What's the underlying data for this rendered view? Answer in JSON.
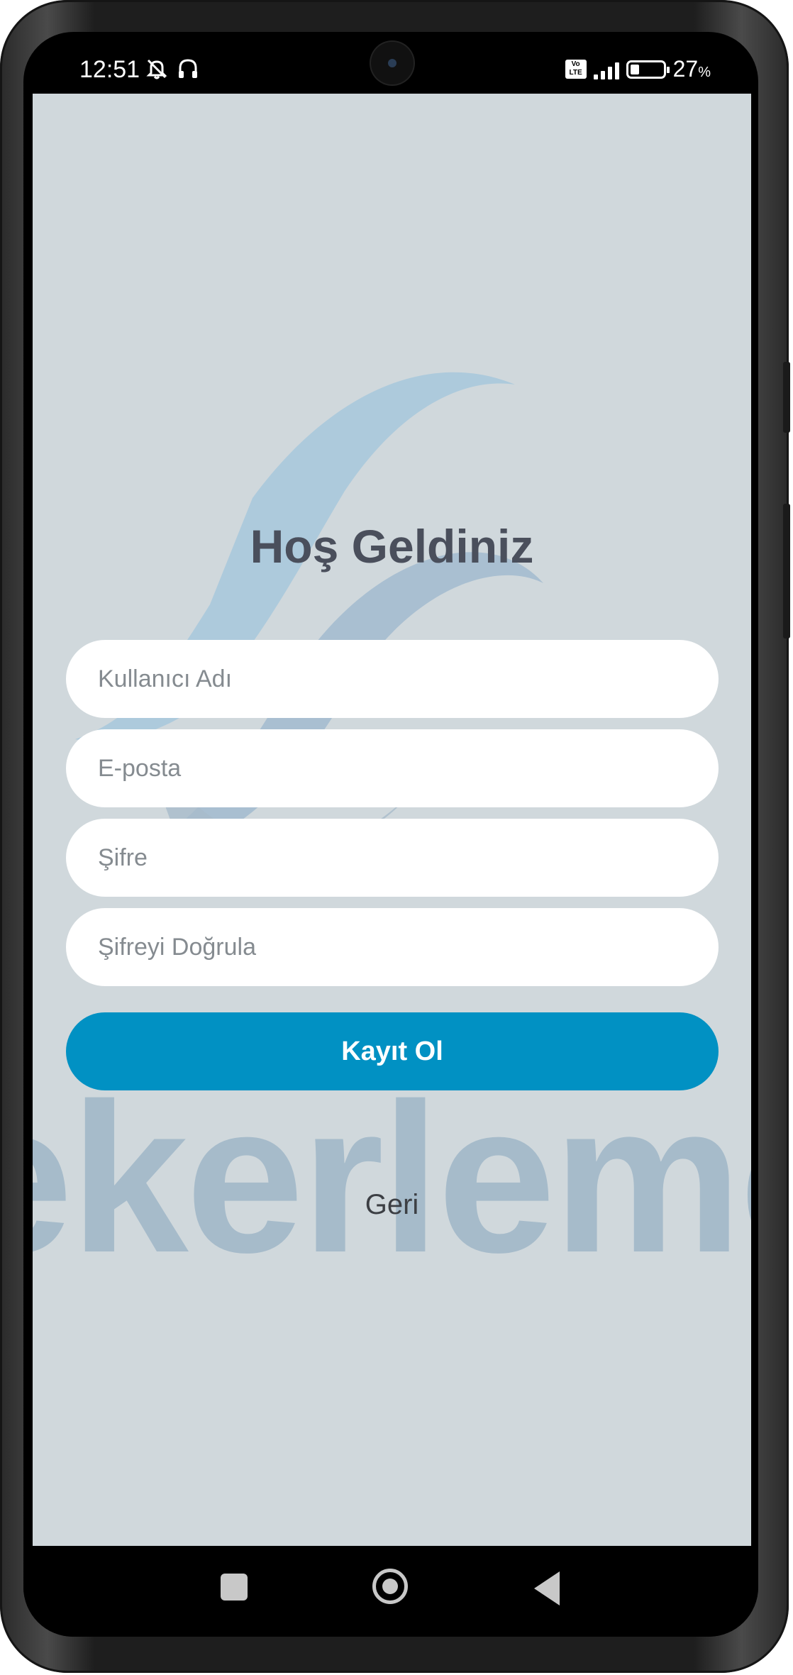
{
  "status_bar": {
    "time": "12:51",
    "volte_label": "Vo LTE",
    "battery_percent": "27",
    "battery_percent_sign": "%",
    "battery_level": 0.27
  },
  "page": {
    "title": "Hoş Geldiniz",
    "watermark_text": "ekerleme"
  },
  "form": {
    "username_placeholder": "Kullanıcı Adı",
    "email_placeholder": "E-posta",
    "password_placeholder": "Şifre",
    "confirm_password_placeholder": "Şifreyi Doğrula",
    "register_label": "Kayıt Ol",
    "back_label": "Geri"
  },
  "colors": {
    "background": "#d0d8dc",
    "primary_button": "#0191c3",
    "title": "#4a4f5c",
    "input_background": "#ffffff"
  }
}
